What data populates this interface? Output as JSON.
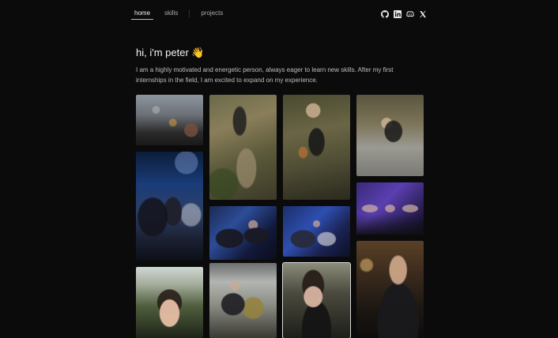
{
  "nav": {
    "items": [
      {
        "label": "home",
        "active": true
      },
      {
        "label": "skills",
        "active": false
      },
      {
        "label": "projects",
        "active": false
      }
    ]
  },
  "social": [
    "github-icon",
    "linkedin-icon",
    "discord-icon",
    "x-icon"
  ],
  "hero": {
    "title": "hi, i'm peter 👋",
    "bio": "I am a highly motivated and energetic person, always eager to learn new skills. After my first internships in the field, I am excited to expand on my experience."
  },
  "gallery": [
    {
      "name": "photo-climbing-wall"
    },
    {
      "name": "photo-climber-from-above-1"
    },
    {
      "name": "photo-climber-from-above-2"
    },
    {
      "name": "photo-climber-on-rock"
    },
    {
      "name": "photo-expert-event"
    },
    {
      "name": "photo-event-blue-lights-1"
    },
    {
      "name": "photo-event-blue-lights-2"
    },
    {
      "name": "photo-friends-purple-lights"
    },
    {
      "name": "photo-selfie-outdoor"
    },
    {
      "name": "photo-mirror-selfie"
    },
    {
      "name": "photo-portrait-night"
    },
    {
      "name": "photo-portrait-dark-jacket"
    }
  ],
  "colors": {
    "background": "#0b0b0b",
    "text": "#f4f4f4",
    "muted": "#bdbdbd"
  }
}
